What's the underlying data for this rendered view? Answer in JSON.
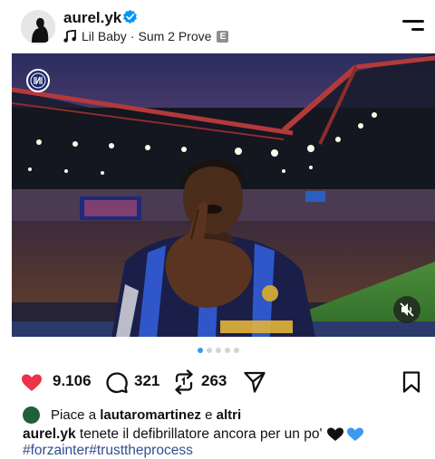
{
  "header": {
    "username": "aurel.yk",
    "music": {
      "artist": "Lil Baby",
      "separator": "·",
      "song": "Sum 2 Prove",
      "explicit_badge": "E"
    }
  },
  "post": {
    "carousel": {
      "total_dots": 5,
      "active_index": 0
    }
  },
  "actions": {
    "likes_count": "9.106",
    "comments_count": "321",
    "reposts_count": "263"
  },
  "likes_line": {
    "prefix": "Piace a",
    "user": "lautaromartinez",
    "conj": "e",
    "others": "altri"
  },
  "caption": {
    "username": "aurel.yk",
    "text": "tenete il defibrillatore ancora per un po'",
    "hashtags": "#forzainter#trusttheprocess"
  },
  "colors": {
    "verified": "#0095f6",
    "hashtag": "#2f4f8f",
    "active_dot": "#3897f0",
    "inter_blue": "#1b3a8c"
  },
  "icons": [
    "verified-icon",
    "music-note-icon",
    "menu-icon",
    "inter-logo-icon",
    "mute-icon",
    "heart-icon",
    "comment-icon",
    "repost-icon",
    "share-icon",
    "bookmark-icon"
  ]
}
